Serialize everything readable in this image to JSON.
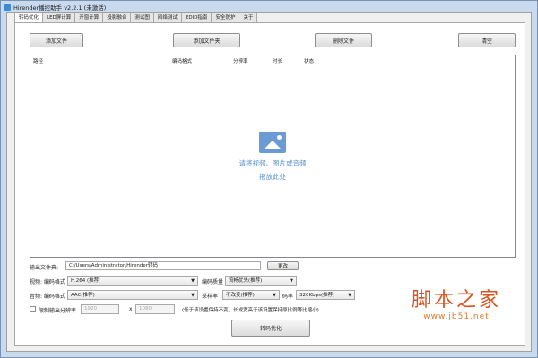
{
  "window": {
    "title": "Hirender播控助手 v2.2.1 (未激活)"
  },
  "tabs": [
    "转码优化",
    "LED屏计算",
    "开窗计算",
    "投影融合",
    "测试图",
    "网络测试",
    "EDID指南",
    "安全防护",
    "关于"
  ],
  "toolbar": {
    "add_file": "添加文件",
    "add_folder": "添加文件夹",
    "delete_file": "删除文件",
    "clear": "清空"
  },
  "list": {
    "columns": [
      "路径",
      "编码格式",
      "分辨率",
      "时长",
      "状态"
    ],
    "drop_hint_1": "请将视频、图片或音频",
    "drop_hint_2": "拖放此处"
  },
  "output": {
    "label": "输出文件夹:",
    "path": "C:/Users/Administrator/Hirender转码",
    "change": "更改"
  },
  "video": {
    "label": "视频: 编码格式",
    "codec": "H.264 (推荐)",
    "quality_label": "编码质量",
    "quality": "流畅优先(推荐)"
  },
  "audio": {
    "label": "音频: 编码格式",
    "codec": "AAC(推荐)",
    "rate_label": "采样率",
    "rate": "不改变(推荐)",
    "bitrate_label": "码率",
    "bitrate": "320Kbps(推荐)"
  },
  "resolution": {
    "label": "限制输出分辨率",
    "width": "1920",
    "x": "x",
    "height": "1080",
    "note": "(低于该设置保持不变，长或宽高于该设置保持原比例等比缩小)",
    "checked": false
  },
  "convert": "转码优化",
  "watermark": {
    "name": "脚本之家",
    "url": "www.jb51.net"
  }
}
